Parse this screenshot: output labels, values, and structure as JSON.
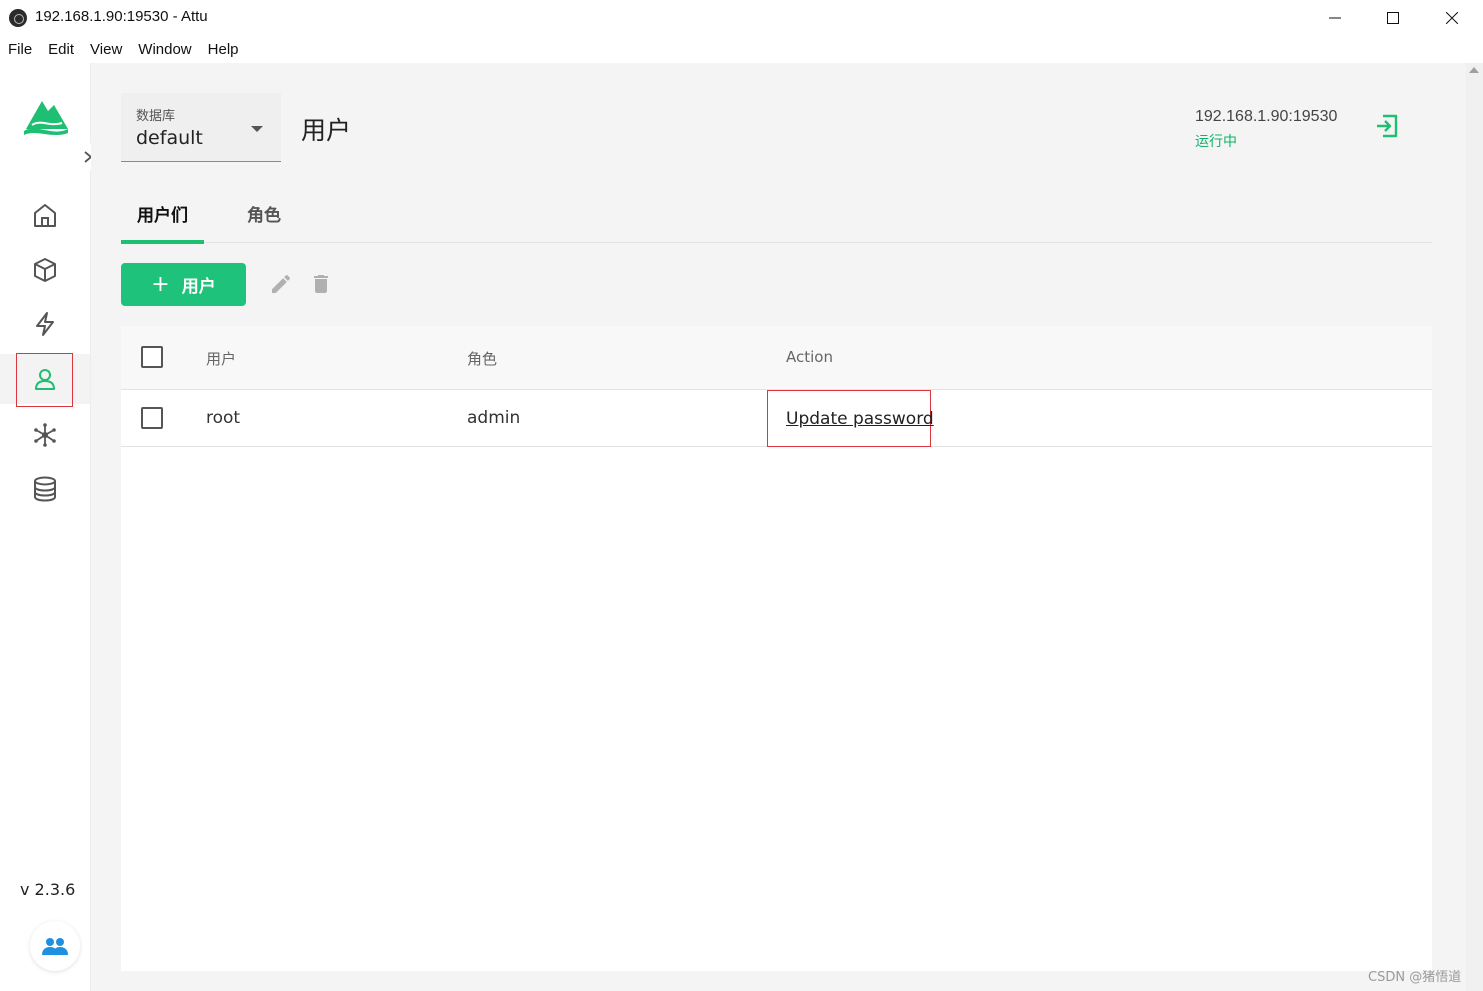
{
  "window": {
    "title": "192.168.1.90:19530 - Attu"
  },
  "menu": [
    "File",
    "Edit",
    "View",
    "Window",
    "Help"
  ],
  "sidebar": {
    "items": [
      {
        "icon": "home-icon",
        "active": false
      },
      {
        "icon": "cube-icon",
        "active": false
      },
      {
        "icon": "lightning-icon",
        "active": false
      },
      {
        "icon": "user-icon",
        "active": true
      },
      {
        "icon": "network-icon",
        "active": false
      },
      {
        "icon": "database-icon",
        "active": false
      }
    ],
    "version": "v 2.3.6"
  },
  "header": {
    "db_label": "数据库",
    "db_value": "default",
    "page_title": "用户",
    "connection_address": "192.168.1.90:19530",
    "connection_status": "运行中"
  },
  "tabs": [
    {
      "label": "用户们",
      "active": true
    },
    {
      "label": "角色",
      "active": false
    }
  ],
  "toolbar": {
    "add_user_label": "用户"
  },
  "table": {
    "headers": [
      "用户",
      "角色",
      "Action"
    ],
    "rows": [
      {
        "user": "root",
        "role": "admin",
        "action": "Update password"
      }
    ]
  },
  "watermark": "CSDN @猪悟道",
  "colors": {
    "accent": "#1ec27a",
    "status_green": "#11b36a",
    "highlight_red": "#d9363e"
  }
}
